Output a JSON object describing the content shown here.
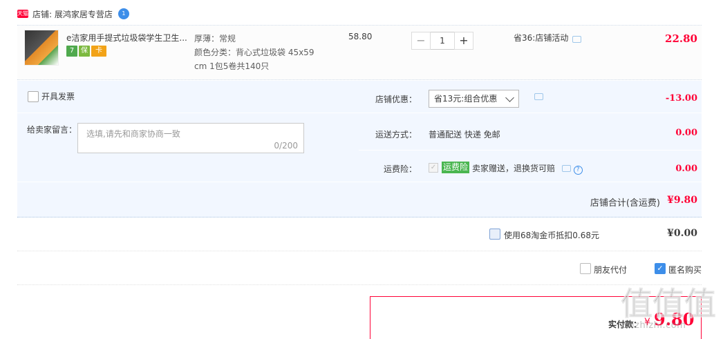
{
  "shop": {
    "badge": "天猫",
    "label": "店铺: 展鸿家居专营店",
    "wangwang": "1"
  },
  "item": {
    "title": "e洁家用手提式垃圾袋学生卫生...",
    "service_icons": [
      "7",
      "保",
      "卡"
    ],
    "spec_lines": [
      "厚薄：常规",
      "颜色分类：背心式垃圾袋 45x59",
      "cm 1包5卷共140只"
    ],
    "price": "58.80",
    "qty_minus": "−",
    "qty_value": "1",
    "qty_plus": "+",
    "promo": "省36:店铺活动",
    "subtotal": "22.80"
  },
  "invoice": {
    "label": "开具发票"
  },
  "memo": {
    "label": "给卖家留言：",
    "placeholder": "选填,请先和商家协商一致",
    "count": "0/200"
  },
  "discount": {
    "label": "店铺优惠：",
    "selected": "省13元:组合优惠",
    "amount": "-13.00"
  },
  "shipping": {
    "label": "运送方式：",
    "value": "普通配送 快递 免邮",
    "amount": "0.00"
  },
  "insurance": {
    "label": "运费险：",
    "checkmark": "✓",
    "badge": "运费险",
    "text": "卖家赠送，退换货可赔",
    "help": "?",
    "amount": "0.00"
  },
  "shop_total": {
    "label": "店铺合计(含运费)",
    "amount": "¥9.80"
  },
  "coins": {
    "label": "使用68淘金币抵扣0.68元",
    "amount": "¥0.00"
  },
  "options": {
    "friend_pay": "朋友代付",
    "anonymous": "匿名购买",
    "anonymous_check": "✓"
  },
  "payment": {
    "label": "实付款：",
    "currency": "¥",
    "amount": "9.80"
  },
  "watermark": {
    "glyphs": [
      "值",
      "值",
      "值"
    ],
    "url": "zhizhizhi.com"
  },
  "colors": {
    "accent": "#ff0036",
    "link": "#3d8ee9",
    "panel": "#f2f7ff"
  }
}
